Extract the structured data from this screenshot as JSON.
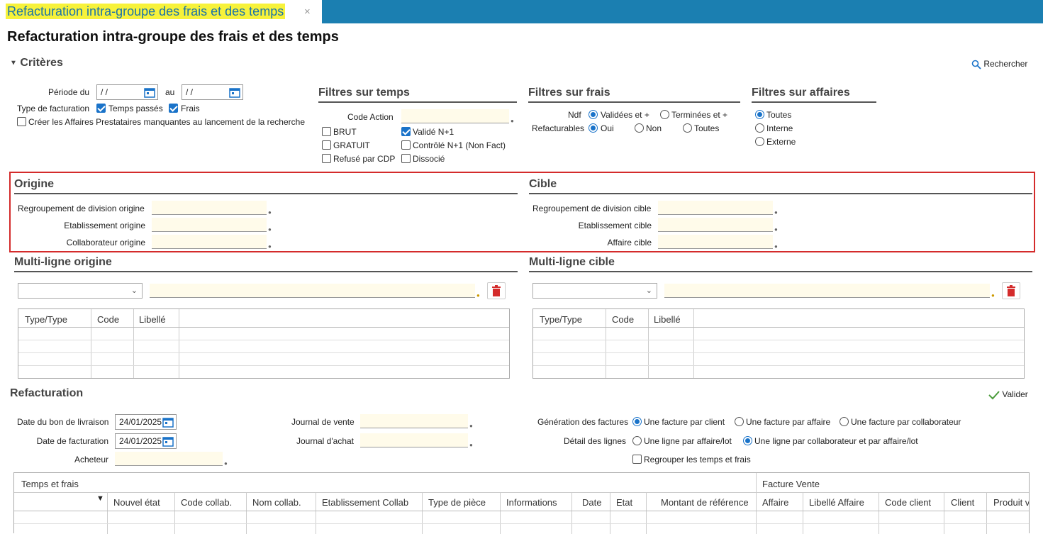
{
  "tab": {
    "title": "Refacturation intra-groupe des frais et des temps",
    "close": "×"
  },
  "page": {
    "title": "Refacturation intra-groupe des frais et des temps"
  },
  "criteres": {
    "header": "Critères",
    "search_label": "Rechercher",
    "periode_label": "Période du",
    "date_from": " /  /",
    "au_label": "au",
    "date_to": " /  /",
    "type_fact_label": "Type de facturation",
    "temps_passes": "Temps passés",
    "frais": "Frais",
    "creer_affaires": "Créer les Affaires Prestataires manquantes au lancement de la recherche"
  },
  "filtres_temps": {
    "title": "Filtres sur temps",
    "code_action_label": "Code Action",
    "brut": "BRUT",
    "gratuit": "GRATUIT",
    "refuse": "Refusé par CDP",
    "valide": "Validé N+1",
    "controle": "Contrôlé N+1 (Non Fact)",
    "dissocie": "Dissocié"
  },
  "filtres_frais": {
    "title": "Filtres sur frais",
    "ndf_label": "Ndf",
    "validees": "Validées et +",
    "terminees": "Terminées et +",
    "refact_label": "Refacturables",
    "oui": "Oui",
    "non": "Non",
    "toutes": "Toutes"
  },
  "filtres_affaires": {
    "title": "Filtres sur affaires",
    "toutes": "Toutes",
    "interne": "Interne",
    "externe": "Externe"
  },
  "origine": {
    "title": "Origine",
    "regroupement": "Regroupement de division origine",
    "etablissement": "Etablissement origine",
    "collaborateur": "Collaborateur origine"
  },
  "cible": {
    "title": "Cible",
    "regroupement": "Regroupement de division cible",
    "etablissement": "Etablissement cible",
    "affaire": "Affaire cible"
  },
  "multi_origine": {
    "title": "Multi-ligne origine",
    "cols": [
      "Type/Type",
      "Code",
      "Libellé"
    ]
  },
  "multi_cible": {
    "title": "Multi-ligne cible",
    "cols": [
      "Type/Type",
      "Code",
      "Libellé"
    ]
  },
  "refacturation": {
    "title": "Refacturation",
    "valider": "Valider",
    "date_bon_label": "Date du bon de livraison",
    "date_bon": "24/01/2025",
    "date_fact_label": "Date de facturation",
    "date_fact": "24/01/2025",
    "acheteur_label": "Acheteur",
    "journal_vente": "Journal de vente",
    "journal_achat": "Journal d'achat",
    "generation_label": "Génération des factures",
    "gen_client": "Une facture par client",
    "gen_affaire": "Une facture par affaire",
    "gen_collab": "Une facture par collaborateur",
    "detail_label": "Détail des lignes",
    "det_affaire": "Une ligne par affaire/lot",
    "det_collab": "Une ligne par collaborateur et par affaire/lot",
    "regrouper": "Regrouper les temps et frais"
  },
  "main_grid": {
    "group1": "Temps et frais",
    "group2": "Facture Vente",
    "cols": [
      "Nouvel état",
      "Code collab.",
      "Nom collab.",
      "Etablissement Collab",
      "Type de pièce",
      "Informations",
      "Date",
      "Etat",
      "Montant de référence",
      "Affaire",
      "Libellé Affaire",
      "Code client",
      "Client",
      "Produit v"
    ]
  }
}
